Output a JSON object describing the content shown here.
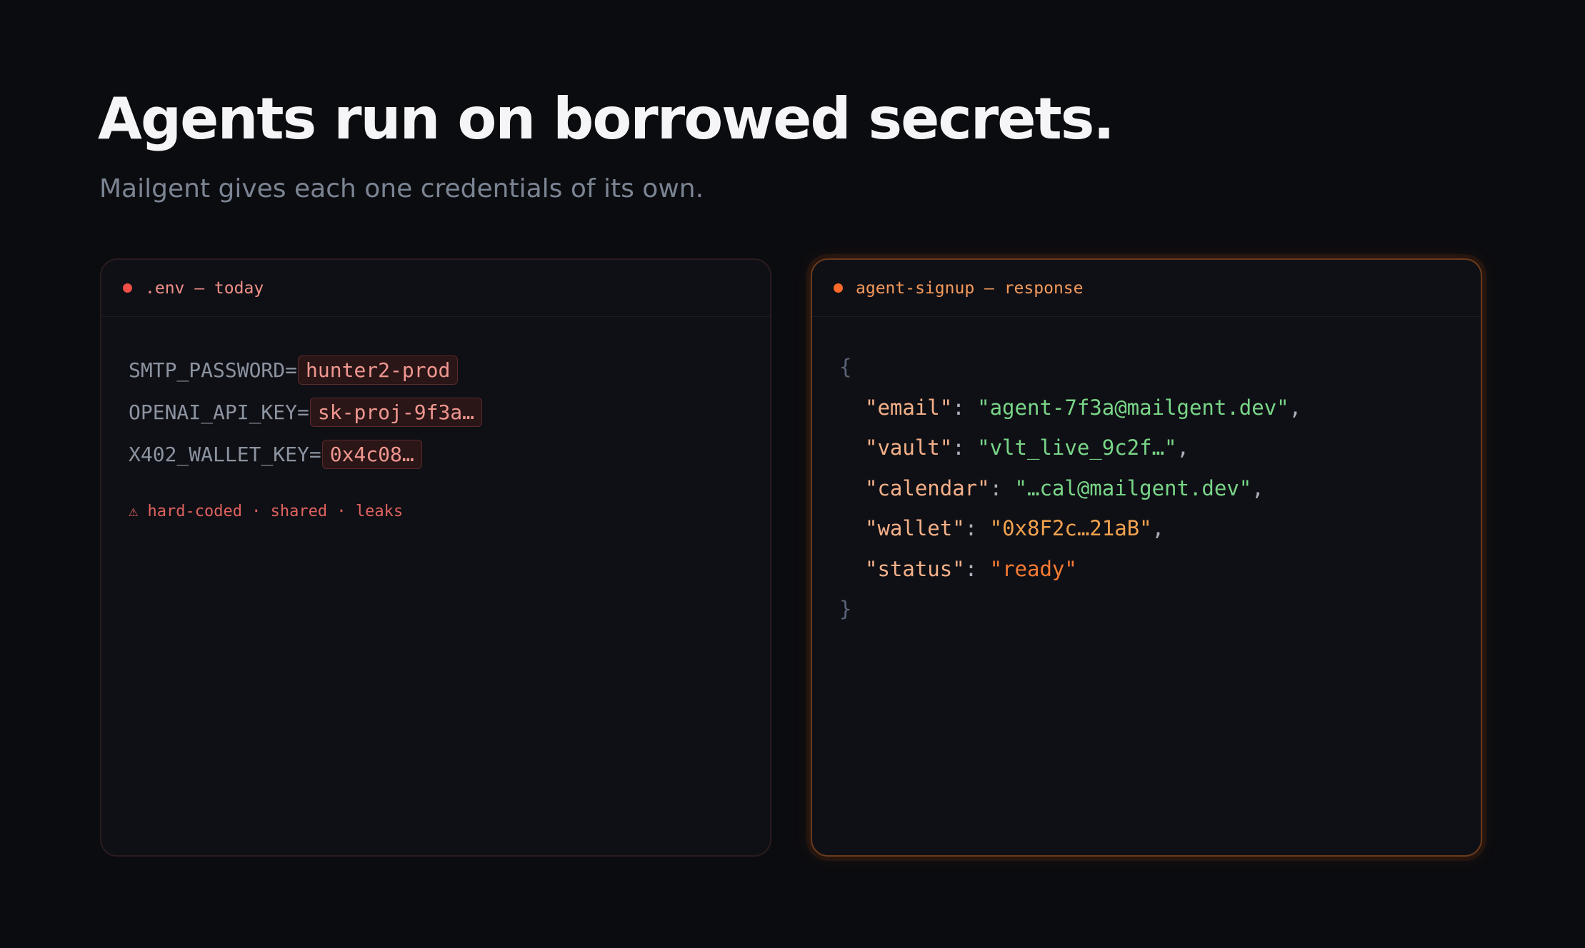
{
  "hero": {
    "title": "Agents run on borrowed secrets.",
    "subtitle": "Mailgent gives each one credentials of its own."
  },
  "left_panel": {
    "title": ".env — today",
    "dot_color": "#ee4f46",
    "title_color": "#f0908a",
    "lines": [
      {
        "key": "SMTP_PASSWORD=",
        "value": "hunter2-prod"
      },
      {
        "key": "OPENAI_API_KEY=",
        "value": "sk-proj-9f3a…"
      },
      {
        "key": "X402_WALLET_KEY=",
        "value": "0x4c08…"
      }
    ],
    "warning": "⚠ hard-coded · shared · leaks"
  },
  "right_panel": {
    "title": "agent-signup — response",
    "dot_color": "#fb6a2a",
    "title_color": "#f59a5c",
    "open_brace": "{",
    "close_brace": "}",
    "entries": [
      {
        "key": "\"email\"",
        "value": "\"agent-7f3a@mailgent.dev\"",
        "comma": ",",
        "color": "#79d588"
      },
      {
        "key": "\"vault\"",
        "value": "\"vlt_live_9c2f…\"",
        "comma": ",",
        "color": "#79d588"
      },
      {
        "key": "\"calendar\"",
        "value": "\"…cal@mailgent.dev\"",
        "comma": ",",
        "color": "#79d588"
      },
      {
        "key": "\"wallet\"",
        "value": "\"0x8F2c…21aB\"",
        "comma": ",",
        "color": "#f0a14e"
      },
      {
        "key": "\"status\"",
        "value": "\"ready\"",
        "comma": "",
        "color": "#f57a34"
      }
    ]
  }
}
